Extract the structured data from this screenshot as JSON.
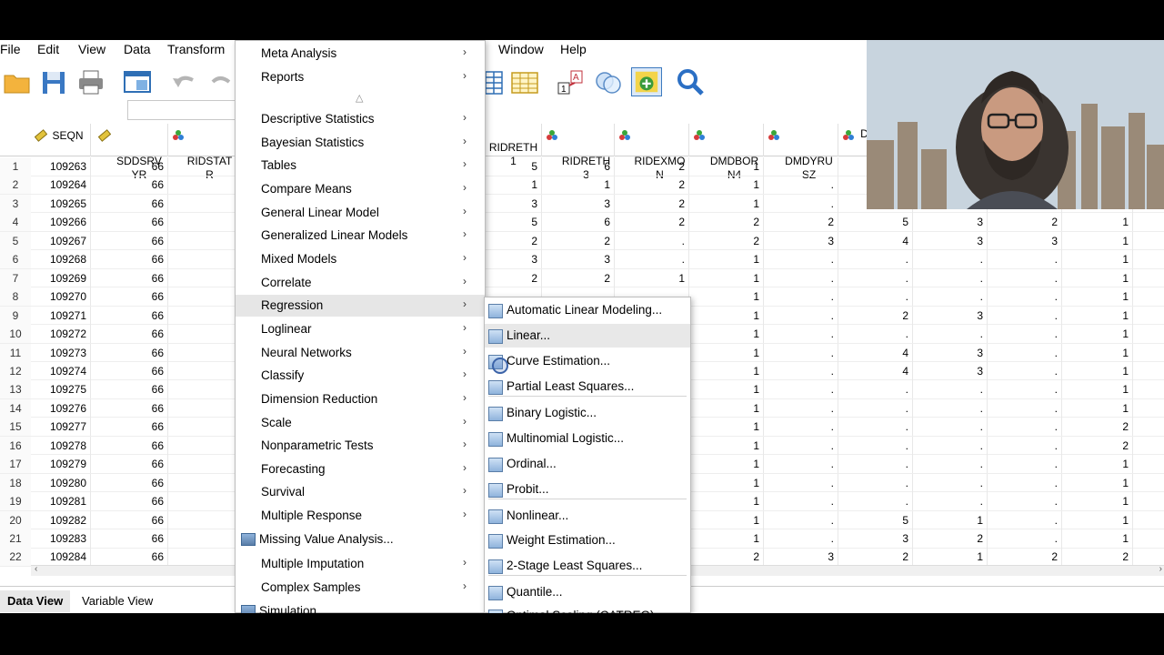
{
  "menubar": {
    "items": [
      "File",
      "Edit",
      "View",
      "Data",
      "Transform",
      "Window",
      "Help"
    ]
  },
  "grid": {
    "columns": [
      {
        "name": "SEQN",
        "icon": "ruler-icon"
      },
      {
        "name": "SDDSRV\nYR",
        "icon": "ruler-icon"
      },
      {
        "name": "RIDSTAT\nR",
        "icon": "nominal-icon"
      },
      {
        "name": "RIDRETH\n1",
        "icon": "nominal-icon"
      },
      {
        "name": "RIDRETH\n3",
        "icon": "nominal-icon"
      },
      {
        "name": "RIDEXMO\nN",
        "icon": "nominal-icon"
      },
      {
        "name": "DMDBOR\nN4",
        "icon": "nominal-icon"
      },
      {
        "name": "DMDYRU\nSZ",
        "icon": "nominal-icon"
      },
      {
        "name": "D",
        "icon": "nominal-icon"
      }
    ],
    "rows": [
      {
        "n": "1",
        "seqn": "109263",
        "sdd": "66",
        "r1": "5",
        "r3": "6",
        "ex": "2",
        "b4": "1",
        "yr": "",
        "c7": "",
        "c8": "",
        "c9": "",
        "c10": ""
      },
      {
        "n": "2",
        "seqn": "109264",
        "sdd": "66",
        "r1": "1",
        "r3": "1",
        "ex": "2",
        "b4": "1",
        "yr": ".",
        "c7": "",
        "c8": "",
        "c9": "",
        "c10": ""
      },
      {
        "n": "3",
        "seqn": "109265",
        "sdd": "66",
        "r1": "3",
        "r3": "3",
        "ex": "2",
        "b4": "1",
        "yr": ".",
        "c7": "",
        "c8": "",
        "c9": "",
        "c10": ""
      },
      {
        "n": "4",
        "seqn": "109266",
        "sdd": "66",
        "r1": "5",
        "r3": "6",
        "ex": "2",
        "b4": "2",
        "yr": "2",
        "c7": "5",
        "c8": "3",
        "c9": "2",
        "c10": "1"
      },
      {
        "n": "5",
        "seqn": "109267",
        "sdd": "66",
        "r1": "2",
        "r3": "2",
        "ex": ".",
        "b4": "2",
        "yr": "3",
        "c7": "4",
        "c8": "3",
        "c9": "3",
        "c10": "1"
      },
      {
        "n": "6",
        "seqn": "109268",
        "sdd": "66",
        "r1": "3",
        "r3": "3",
        "ex": ".",
        "b4": "1",
        "yr": ".",
        "c7": ".",
        "c8": ".",
        "c9": ".",
        "c10": "1"
      },
      {
        "n": "7",
        "seqn": "109269",
        "sdd": "66",
        "r1": "2",
        "r3": "2",
        "ex": "1",
        "b4": "1",
        "yr": ".",
        "c7": ".",
        "c8": ".",
        "c9": ".",
        "c10": "1"
      },
      {
        "n": "8",
        "seqn": "109270",
        "sdd": "66",
        "r1": "",
        "r3": "",
        "ex": "",
        "b4": "1",
        "yr": ".",
        "c7": ".",
        "c8": ".",
        "c9": ".",
        "c10": "1"
      },
      {
        "n": "9",
        "seqn": "109271",
        "sdd": "66",
        "r1": "",
        "r3": "",
        "ex": "",
        "b4": "1",
        "yr": ".",
        "c7": "2",
        "c8": "3",
        "c9": ".",
        "c10": "1"
      },
      {
        "n": "10",
        "seqn": "109272",
        "sdd": "66",
        "r1": "",
        "r3": "",
        "ex": "",
        "b4": "1",
        "yr": ".",
        "c7": ".",
        "c8": ".",
        "c9": ".",
        "c10": "1"
      },
      {
        "n": "11",
        "seqn": "109273",
        "sdd": "66",
        "r1": "",
        "r3": "",
        "ex": "",
        "b4": "1",
        "yr": ".",
        "c7": "4",
        "c8": "3",
        "c9": ".",
        "c10": "1"
      },
      {
        "n": "12",
        "seqn": "109274",
        "sdd": "66",
        "r1": "",
        "r3": "",
        "ex": "",
        "b4": "1",
        "yr": ".",
        "c7": "4",
        "c8": "3",
        "c9": ".",
        "c10": "1"
      },
      {
        "n": "13",
        "seqn": "109275",
        "sdd": "66",
        "r1": "",
        "r3": "",
        "ex": "",
        "b4": "1",
        "yr": ".",
        "c7": ".",
        "c8": ".",
        "c9": ".",
        "c10": "1"
      },
      {
        "n": "14",
        "seqn": "109276",
        "sdd": "66",
        "r1": "",
        "r3": "",
        "ex": "",
        "b4": "1",
        "yr": ".",
        "c7": ".",
        "c8": ".",
        "c9": ".",
        "c10": "1"
      },
      {
        "n": "15",
        "seqn": "109277",
        "sdd": "66",
        "r1": "",
        "r3": "",
        "ex": "",
        "b4": "1",
        "yr": ".",
        "c7": ".",
        "c8": ".",
        "c9": ".",
        "c10": "2"
      },
      {
        "n": "16",
        "seqn": "109278",
        "sdd": "66",
        "r1": "",
        "r3": "",
        "ex": "",
        "b4": "1",
        "yr": ".",
        "c7": ".",
        "c8": ".",
        "c9": ".",
        "c10": "2"
      },
      {
        "n": "17",
        "seqn": "109279",
        "sdd": "66",
        "r1": "",
        "r3": "",
        "ex": "",
        "b4": "1",
        "yr": ".",
        "c7": ".",
        "c8": ".",
        "c9": ".",
        "c10": "1"
      },
      {
        "n": "18",
        "seqn": "109280",
        "sdd": "66",
        "r1": "",
        "r3": "",
        "ex": "",
        "b4": "1",
        "yr": ".",
        "c7": ".",
        "c8": ".",
        "c9": ".",
        "c10": "1"
      },
      {
        "n": "19",
        "seqn": "109281",
        "sdd": "66",
        "r1": "",
        "r3": "",
        "ex": "",
        "b4": "1",
        "yr": ".",
        "c7": ".",
        "c8": ".",
        "c9": ".",
        "c10": "1"
      },
      {
        "n": "20",
        "seqn": "109282",
        "sdd": "66",
        "r1": "",
        "r3": "",
        "ex": "",
        "b4": "1",
        "yr": ".",
        "c7": "5",
        "c8": "1",
        "c9": ".",
        "c10": "1"
      },
      {
        "n": "21",
        "seqn": "109283",
        "sdd": "66",
        "r1": "",
        "r3": "",
        "ex": "",
        "b4": "1",
        "yr": ".",
        "c7": "3",
        "c8": "2",
        "c9": ".",
        "c10": "1"
      },
      {
        "n": "22",
        "seqn": "109284",
        "sdd": "66",
        "r1": "",
        "r3": "",
        "ex": "",
        "b4": "2",
        "yr": "3",
        "c7": "2",
        "c8": "1",
        "c9": "2",
        "c10": "2"
      }
    ]
  },
  "tabs": {
    "data_view": "Data View",
    "variable_view": "Variable View"
  },
  "analyze_menu": {
    "items": [
      {
        "label": "Meta Analysis",
        "submenu": true
      },
      {
        "label": "Reports",
        "submenu": true
      },
      {
        "label": "Descriptive Statistics",
        "submenu": true
      },
      {
        "label": "Bayesian Statistics",
        "submenu": true
      },
      {
        "label": "Tables",
        "submenu": true
      },
      {
        "label": "Compare Means",
        "submenu": true
      },
      {
        "label": "General Linear Model",
        "submenu": true
      },
      {
        "label": "Generalized Linear Models",
        "submenu": true
      },
      {
        "label": "Mixed Models",
        "submenu": true
      },
      {
        "label": "Correlate",
        "submenu": true
      },
      {
        "label": "Regression",
        "submenu": true
      },
      {
        "label": "Loglinear",
        "submenu": true
      },
      {
        "label": "Neural Networks",
        "submenu": true
      },
      {
        "label": "Classify",
        "submenu": true
      },
      {
        "label": "Dimension Reduction",
        "submenu": true
      },
      {
        "label": "Scale",
        "submenu": true
      },
      {
        "label": "Nonparametric Tests",
        "submenu": true
      },
      {
        "label": "Forecasting",
        "submenu": true
      },
      {
        "label": "Survival",
        "submenu": true
      },
      {
        "label": "Multiple Response",
        "submenu": true
      },
      {
        "label": "Missing Value Analysis...",
        "submenu": false
      },
      {
        "label": "Multiple Imputation",
        "submenu": true
      },
      {
        "label": "Complex Samples",
        "submenu": true
      },
      {
        "label": "Simulation...",
        "submenu": false
      }
    ],
    "arrow_glyph": "›",
    "scroll_up_glyph": "△"
  },
  "regression_menu": {
    "items": [
      {
        "label": "Automatic Linear Modeling..."
      },
      {
        "label": "Linear..."
      },
      {
        "label": "Curve Estimation..."
      },
      {
        "label": "Partial Least Squares..."
      },
      {
        "label": "Binary Logistic..."
      },
      {
        "label": "Multinomial Logistic..."
      },
      {
        "label": "Ordinal..."
      },
      {
        "label": "Probit..."
      },
      {
        "label": "Nonlinear..."
      },
      {
        "label": "Weight Estimation..."
      },
      {
        "label": "2-Stage Least Squares..."
      },
      {
        "label": "Quantile..."
      },
      {
        "label": "Optimal Scaling (CATREG)..."
      }
    ]
  }
}
